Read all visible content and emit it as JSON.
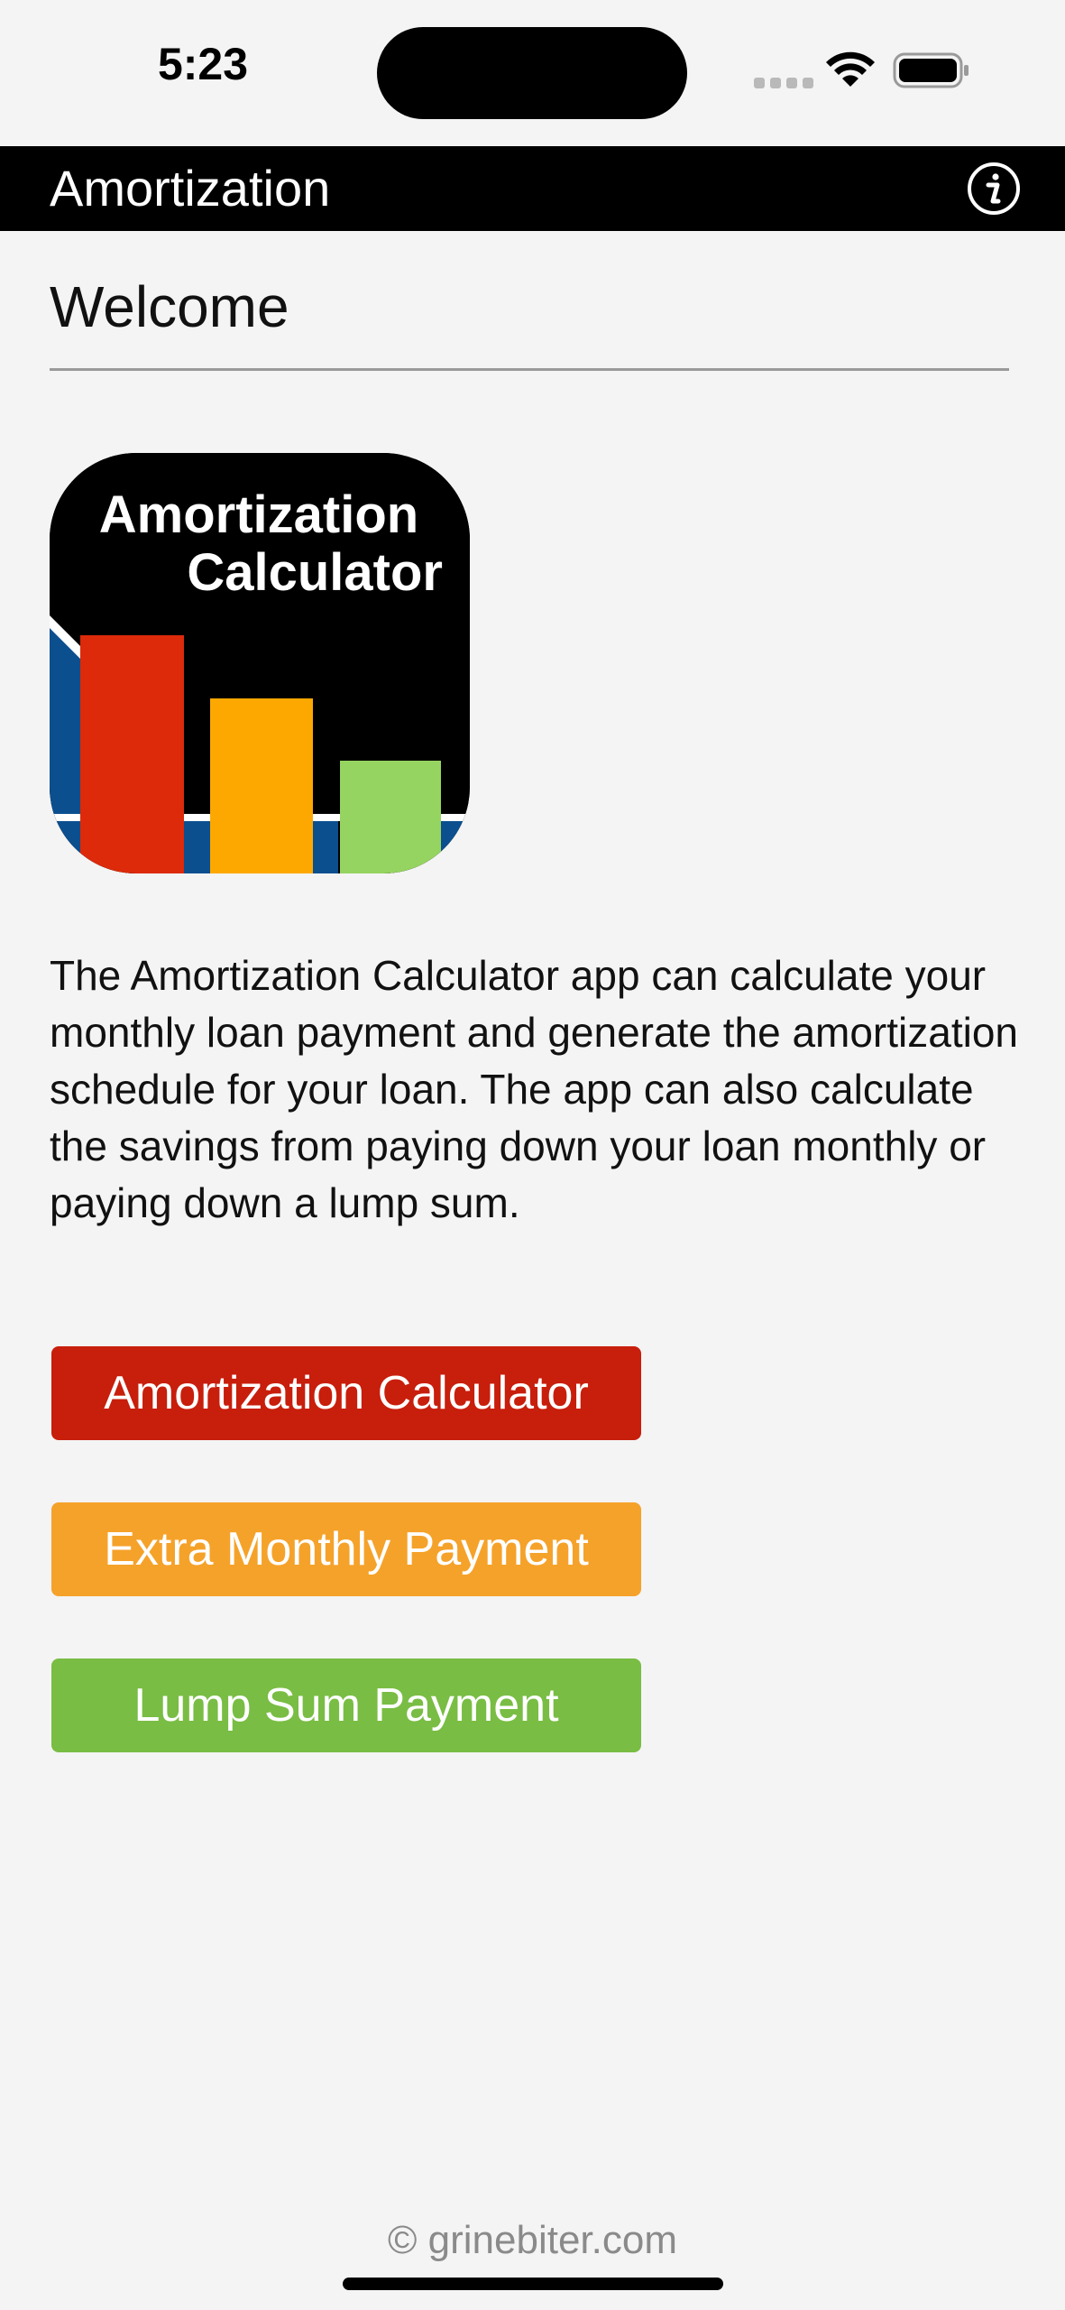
{
  "status_bar": {
    "time": "5:23"
  },
  "nav": {
    "title": "Amortization",
    "info_icon": "info-icon"
  },
  "content": {
    "heading": "Welcome",
    "app_icon": {
      "line1": "Amortization",
      "line2": "Calculator"
    },
    "description": "The Amortization Calculator app can calculate your monthly loan payment and generate the amortization schedule for your loan. The app can also calculate the savings from paying down your loan monthly or paying down a lump sum."
  },
  "buttons": {
    "amortization_calculator": {
      "label": "Amortization Calculator",
      "color": "#c81e0c"
    },
    "extra_monthly_payment": {
      "label": "Extra Monthly Payment",
      "color": "#f5a22a"
    },
    "lump_sum_payment": {
      "label": "Lump Sum Payment",
      "color": "#79bd44"
    }
  },
  "footer": {
    "text": "© grinebiter.com"
  }
}
